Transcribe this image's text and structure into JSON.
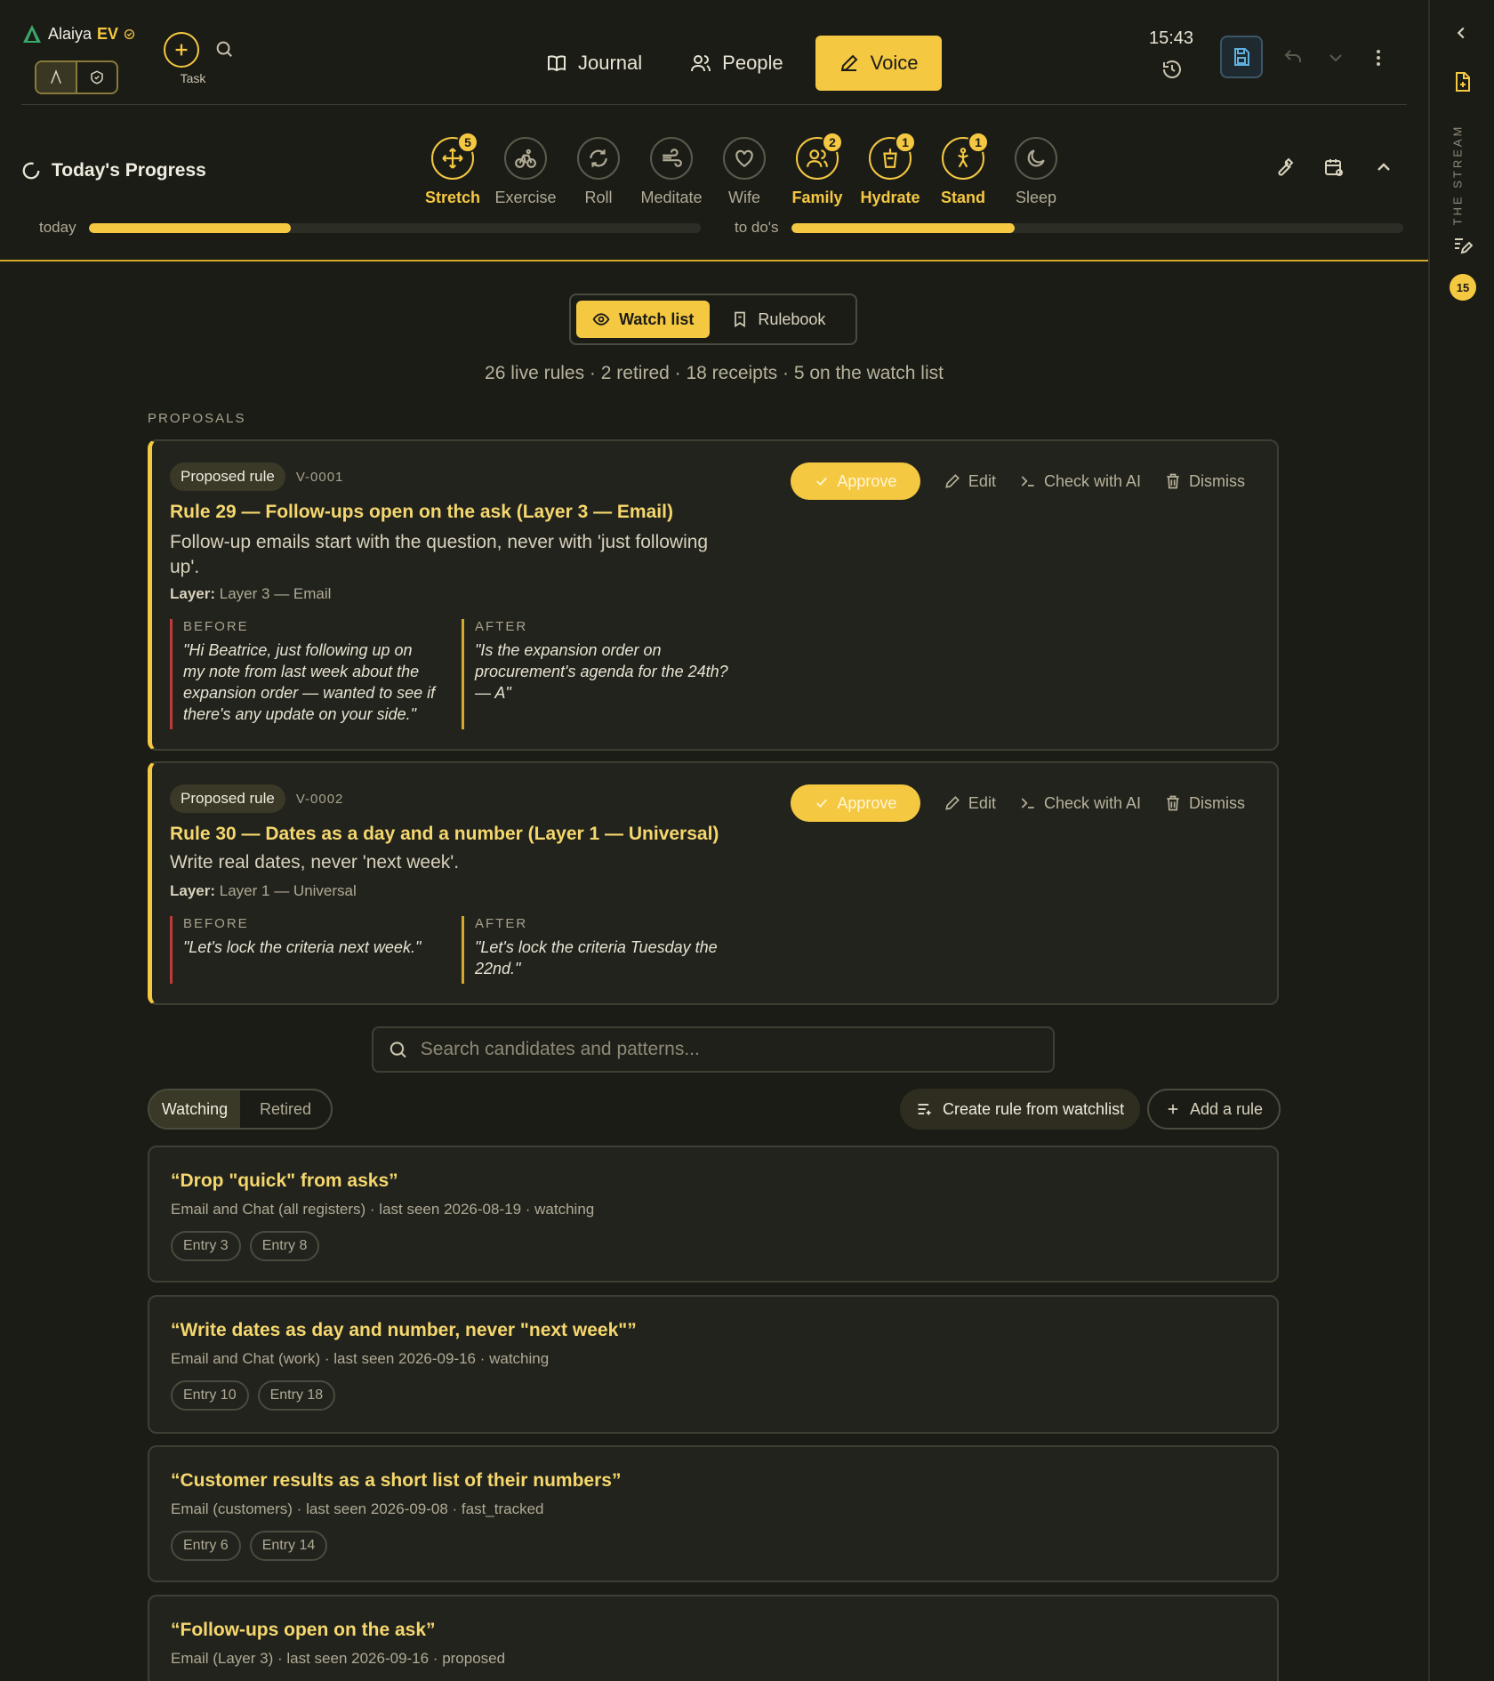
{
  "app": {
    "brand": "Alaiya",
    "brand_suffix": "EV"
  },
  "header": {
    "task_label": "Task",
    "nav": [
      {
        "label": "Journal",
        "icon": "book-icon"
      },
      {
        "label": "People",
        "icon": "people-icon"
      },
      {
        "label": "Voice",
        "icon": "pen-icon",
        "active": true
      }
    ],
    "clock": "15:43"
  },
  "progress": {
    "title": "Today's Progress",
    "habits": [
      {
        "label": "Stretch",
        "badge": "5",
        "active": true,
        "icon": "move-icon"
      },
      {
        "label": "Exercise",
        "badge": "",
        "active": false,
        "icon": "bike-icon"
      },
      {
        "label": "Roll",
        "badge": "",
        "active": false,
        "icon": "refresh-icon"
      },
      {
        "label": "Meditate",
        "badge": "",
        "active": false,
        "icon": "wind-icon"
      },
      {
        "label": "Wife",
        "badge": "",
        "active": false,
        "icon": "heart-icon"
      },
      {
        "label": "Family",
        "badge": "2",
        "active": true,
        "icon": "family-icon"
      },
      {
        "label": "Hydrate",
        "badge": "1",
        "active": true,
        "icon": "cup-icon"
      },
      {
        "label": "Stand",
        "badge": "1",
        "active": true,
        "icon": "stand-icon"
      },
      {
        "label": "Sleep",
        "badge": "",
        "active": false,
        "icon": "moon-icon"
      }
    ],
    "today_label": "today",
    "today_fraction": 0.33,
    "todos_label": "to do's",
    "todos_fraction": 0.365
  },
  "view_toggle": {
    "watch": "Watch list",
    "rulebook": "Rulebook"
  },
  "stats": "26 live rules · 2 retired · 18 receipts · 5 on the watch list",
  "proposals_label": "PROPOSALS",
  "proposals": [
    {
      "pill": "Proposed rule",
      "id": "V-0001",
      "title": "Rule 29 — Follow-ups open on the ask (Layer 3 — Email)",
      "desc": "Follow-up emails start with the question, never with 'just following up'.",
      "layer_key": "Layer:",
      "layer_val": "Layer 3 — Email",
      "before_label": "BEFORE",
      "before": "\"Hi Beatrice, just following up on my note from last week about the expansion order — wanted to see if there's any update on your side.\"",
      "after_label": "AFTER",
      "after": "\"Is the expansion order on procurement's agenda for the 24th? — A\""
    },
    {
      "pill": "Proposed rule",
      "id": "V-0002",
      "title": "Rule 30 — Dates as a day and a number (Layer 1 — Universal)",
      "desc": "Write real dates, never 'next week'.",
      "layer_key": "Layer:",
      "layer_val": "Layer 1 — Universal",
      "before_label": "BEFORE",
      "before": "\"Let's lock the criteria next week.\"",
      "after_label": "AFTER",
      "after": "\"Let's lock the criteria Tuesday the 22nd.\""
    }
  ],
  "actions": {
    "approve": "Approve",
    "edit": "Edit",
    "check": "Check with AI",
    "dismiss": "Dismiss"
  },
  "search": {
    "placeholder": "Search candidates and patterns..."
  },
  "watch_tabs": {
    "watching": "Watching",
    "retired": "Retired"
  },
  "buttons": {
    "create": "Create rule from watchlist",
    "add": "Add a rule"
  },
  "watchlist": [
    {
      "title": "“Drop \"quick\" from asks”",
      "meta": "Email and Chat (all registers) · last seen 2026-08-19 · watching",
      "chips": [
        "Entry 3",
        "Entry 8"
      ]
    },
    {
      "title": "“Write dates as day and number, never \"next week\"”",
      "meta": "Email and Chat (work) · last seen 2026-09-16 · watching",
      "chips": [
        "Entry 10",
        "Entry 18"
      ]
    },
    {
      "title": "“Customer results as a short list of their numbers”",
      "meta": "Email (customers) · last seen 2026-09-08 · fast_tracked",
      "chips": [
        "Entry 6",
        "Entry 14"
      ]
    },
    {
      "title": "“Follow-ups open on the ask”",
      "meta": "Email (Layer 3) · last seen 2026-09-16 · proposed",
      "chips": []
    }
  ],
  "rail": {
    "stream_label": "THE STREAM",
    "badge": "15"
  },
  "colors": {
    "accent": "#f5c842",
    "background": "#1b1c16",
    "card": "#22231c",
    "before_border": "#c03a3a"
  }
}
